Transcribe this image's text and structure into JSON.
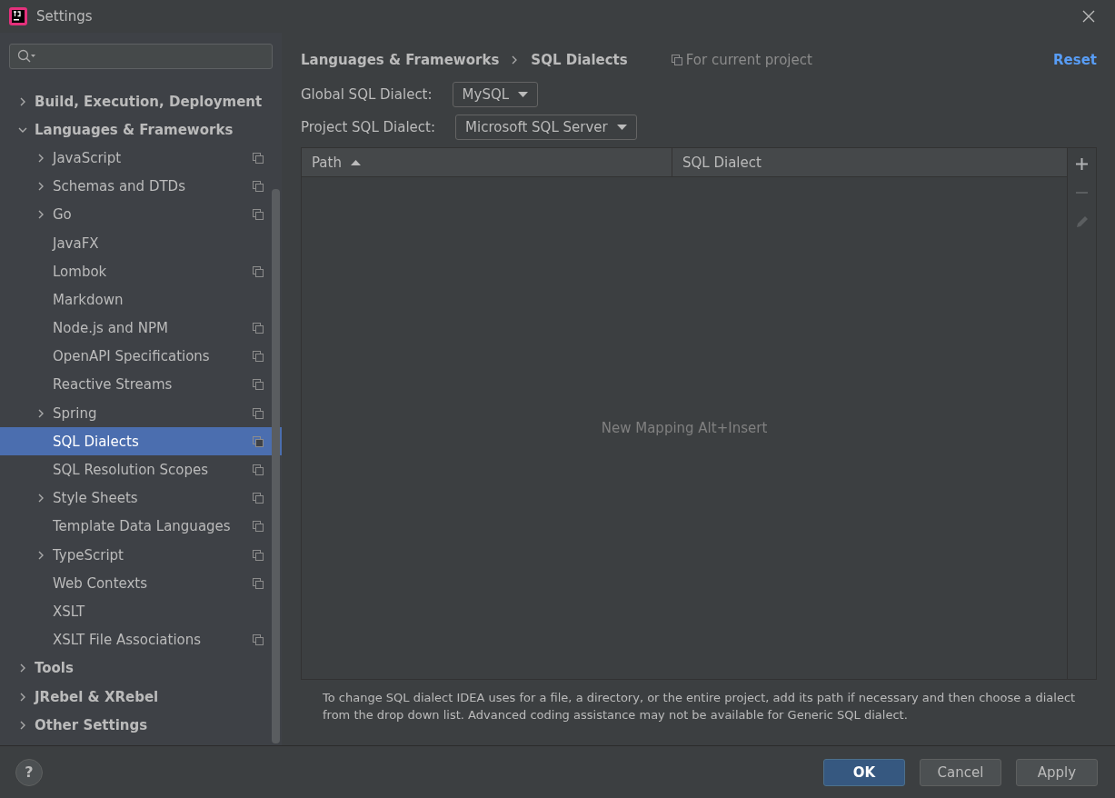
{
  "window": {
    "title": "Settings"
  },
  "tree": [
    {
      "label": "Build, Execution, Deployment",
      "expanded": false
    },
    {
      "label": "Languages & Frameworks",
      "expanded": true,
      "children": [
        {
          "label": "JavaScript",
          "expanded": false,
          "project_level": true,
          "selected": false
        },
        {
          "label": "Schemas and DTDs",
          "expanded": false,
          "project_level": true,
          "selected": false
        },
        {
          "label": "Go",
          "expanded": false,
          "project_level": true,
          "selected": false
        },
        {
          "label": "JavaFX",
          "project_level": false,
          "selected": false
        },
        {
          "label": "Lombok",
          "project_level": true,
          "selected": false
        },
        {
          "label": "Markdown",
          "project_level": false,
          "selected": false
        },
        {
          "label": "Node.js and NPM",
          "project_level": true,
          "selected": false
        },
        {
          "label": "OpenAPI Specifications",
          "project_level": true,
          "selected": false
        },
        {
          "label": "Reactive Streams",
          "project_level": true,
          "selected": false
        },
        {
          "label": "Spring",
          "expanded": false,
          "project_level": true,
          "selected": false
        },
        {
          "label": "SQL Dialects",
          "project_level": true,
          "selected": true
        },
        {
          "label": "SQL Resolution Scopes",
          "project_level": true,
          "selected": false
        },
        {
          "label": "Style Sheets",
          "expanded": false,
          "project_level": true,
          "selected": false
        },
        {
          "label": "Template Data Languages",
          "project_level": true,
          "selected": false
        },
        {
          "label": "TypeScript",
          "expanded": false,
          "project_level": true,
          "selected": false
        },
        {
          "label": "Web Contexts",
          "project_level": true,
          "selected": false
        },
        {
          "label": "XSLT",
          "project_level": false,
          "selected": false
        },
        {
          "label": "XSLT File Associations",
          "project_level": true,
          "selected": false
        }
      ]
    },
    {
      "label": "Tools",
      "expanded": false
    },
    {
      "label": "JRebel & XRebel",
      "expanded": false
    },
    {
      "label": "Other Settings",
      "expanded": false
    }
  ],
  "breadcrumb": [
    "Languages & Frameworks",
    "SQL Dialects"
  ],
  "scope": "For current project",
  "reset": "Reset",
  "fields": [
    {
      "label": "Global SQL Dialect:",
      "value": "MySQL"
    },
    {
      "label": "Project SQL Dialect:",
      "value": "Microsoft SQL Server"
    }
  ],
  "table": {
    "columns": [
      {
        "label": "Path",
        "sorted": true
      },
      {
        "label": "SQL Dialect",
        "sorted": false
      }
    ],
    "empty_text": "New Mapping Alt+Insert"
  },
  "toolbar": [
    {
      "kind": "add",
      "disabled": false
    },
    {
      "kind": "remove",
      "disabled": true
    },
    {
      "kind": "edit",
      "disabled": true
    }
  ],
  "help_text": "To change SQL dialect IDEA uses for a file, a directory, or the entire project, add its path if necessary and then choose a dialect from the drop down list. Advanced coding assistance may not be available for Generic SQL dialect.",
  "help_button": "?",
  "buttons": [
    {
      "label": "OK",
      "primary": true
    },
    {
      "label": "Cancel",
      "primary": false
    },
    {
      "label": "Apply",
      "primary": false
    }
  ]
}
